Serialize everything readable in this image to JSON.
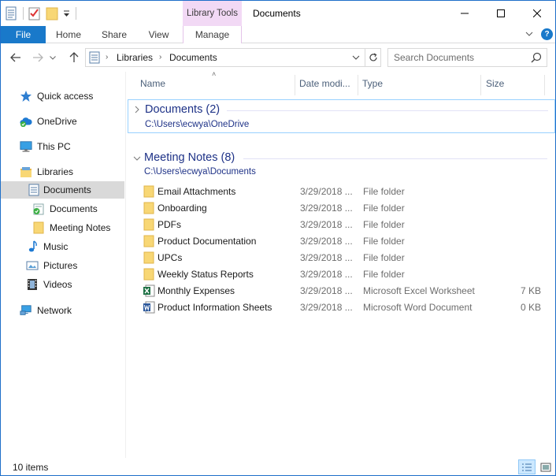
{
  "window": {
    "title": "Documents",
    "context_tab_group": "Library Tools"
  },
  "ribbon": {
    "tabs": [
      "File",
      "Home",
      "Share",
      "View",
      "Manage"
    ],
    "help_label": "?"
  },
  "address": {
    "breadcrumbs": [
      "Libraries",
      "Documents"
    ],
    "search_placeholder": "Search Documents"
  },
  "nav_pane": {
    "items": [
      {
        "label": "Quick access",
        "icon": "star-icon"
      },
      {
        "label": "OneDrive",
        "icon": "cloud-icon"
      },
      {
        "label": "This PC",
        "icon": "monitor-icon"
      },
      {
        "label": "Libraries",
        "icon": "libraries-icon"
      },
      {
        "label": "Documents",
        "icon": "document-library-icon"
      },
      {
        "label": "Documents",
        "icon": "synced-folder-icon"
      },
      {
        "label": "Meeting Notes",
        "icon": "folder-icon"
      },
      {
        "label": "Music",
        "icon": "music-icon"
      },
      {
        "label": "Pictures",
        "icon": "pictures-icon"
      },
      {
        "label": "Videos",
        "icon": "videos-icon"
      },
      {
        "label": "Network",
        "icon": "network-icon"
      }
    ]
  },
  "columns": {
    "name": "Name",
    "date": "Date modi...",
    "type": "Type",
    "size": "Size"
  },
  "groups": [
    {
      "title": "Documents (2)",
      "path": "C:\\Users\\ecwya\\OneDrive",
      "expanded": false
    },
    {
      "title": "Meeting Notes (8)",
      "path": "C:\\Users\\ecwya\\Documents",
      "expanded": true
    }
  ],
  "files": [
    {
      "name": "Email Attachments",
      "date": "3/29/2018 ...",
      "type": "File folder",
      "size": "",
      "icon": "folder-icon"
    },
    {
      "name": "Onboarding",
      "date": "3/29/2018 ...",
      "type": "File folder",
      "size": "",
      "icon": "folder-icon"
    },
    {
      "name": "PDFs",
      "date": "3/29/2018 ...",
      "type": "File folder",
      "size": "",
      "icon": "folder-icon"
    },
    {
      "name": "Product Documentation",
      "date": "3/29/2018 ...",
      "type": "File folder",
      "size": "",
      "icon": "folder-icon"
    },
    {
      "name": "UPCs",
      "date": "3/29/2018 ...",
      "type": "File folder",
      "size": "",
      "icon": "folder-icon"
    },
    {
      "name": "Weekly Status Reports",
      "date": "3/29/2018 ...",
      "type": "File folder",
      "size": "",
      "icon": "folder-icon"
    },
    {
      "name": "Monthly Expenses",
      "date": "3/29/2018 ...",
      "type": "Microsoft Excel Worksheet",
      "size": "7 KB",
      "icon": "excel-icon"
    },
    {
      "name": "Product Information Sheets",
      "date": "3/29/2018 ...",
      "type": "Microsoft Word Document",
      "size": "0 KB",
      "icon": "word-icon"
    }
  ],
  "status": {
    "item_count": "10 items"
  },
  "colors": {
    "accent": "#1979ca",
    "context_tab": "#f2d9f5",
    "group_header": "#1e3287",
    "selection": "#d9d9d9",
    "folder": "#f8d775"
  }
}
